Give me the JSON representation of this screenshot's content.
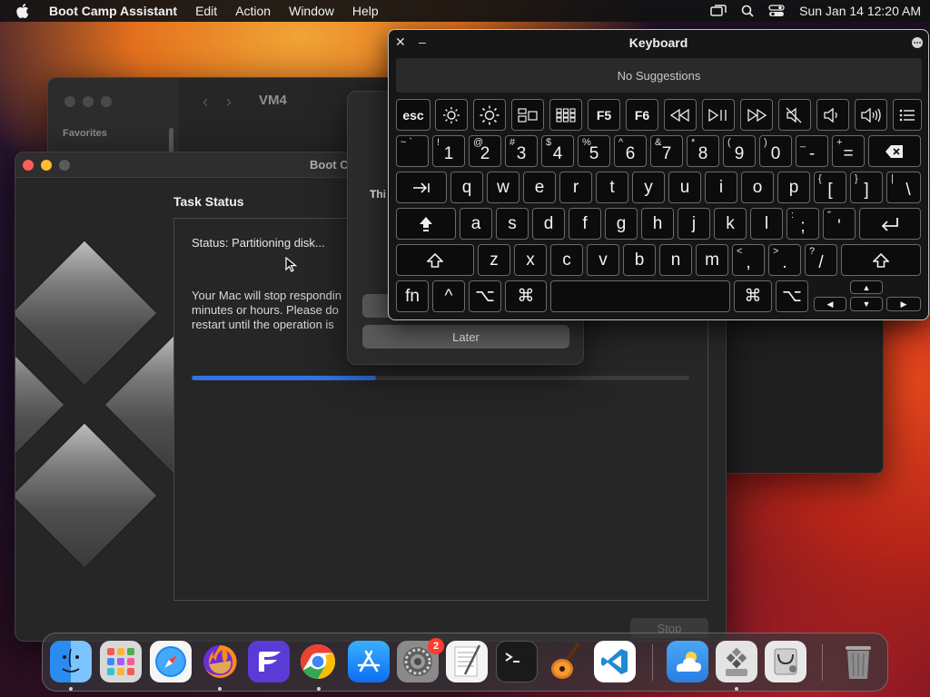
{
  "menubar": {
    "app_name": "Boot Camp Assistant",
    "items": [
      "Edit",
      "Action",
      "Window",
      "Help"
    ],
    "clock": "Sun Jan 14  12:20 AM"
  },
  "vm_window": {
    "title": "VM4",
    "sidebar_heading": "Favorites"
  },
  "bootcamp": {
    "title": "Boot C",
    "task_heading": "Task Status",
    "status": "Status: Partitioning disk...",
    "warning": "Your Mac will stop respondin\nminutes or hours. Please do\nrestart until the operation is",
    "progress": 0.37,
    "stop_label": "Stop"
  },
  "dialog": {
    "text": "Thi",
    "later_label": "Later"
  },
  "keyboard": {
    "title": "Keyboard",
    "suggestions": "No Suggestions",
    "keys": {
      "esc": "esc",
      "f5": "F5",
      "f6": "F6",
      "tilde_alt": "~ `",
      "n1": "1",
      "n1_alt": "!",
      "n2": "2",
      "n2_alt": "@",
      "n3": "3",
      "n3_alt": "#",
      "n4": "4",
      "n4_alt": "$",
      "n5": "5",
      "n5_alt": "%",
      "n6": "6",
      "n6_alt": "^",
      "n7": "7",
      "n7_alt": "&",
      "n8": "8",
      "n8_alt": "*",
      "n9": "9",
      "n9_alt": "(",
      "n0": "0",
      "n0_alt": ")",
      "minus": "-",
      "minus_alt": "_",
      "equals": "=",
      "equals_alt": "+",
      "q": "q",
      "w": "w",
      "e": "e",
      "r": "r",
      "t": "t",
      "y": "y",
      "u": "u",
      "i": "i",
      "o": "o",
      "p": "p",
      "lbracket": "[",
      "lbracket_alt": "{",
      "rbracket": "]",
      "rbracket_alt": "}",
      "backslash": "\\",
      "backslash_alt": "|",
      "a": "a",
      "s": "s",
      "d": "d",
      "f": "f",
      "g": "g",
      "h": "h",
      "j": "j",
      "k": "k",
      "l": "l",
      "semicolon": ";",
      "semicolon_alt": ":",
      "quote": "'",
      "quote_alt": "\"",
      "z": "z",
      "x": "x",
      "c": "c",
      "v": "v",
      "b": "b",
      "n": "n",
      "m": "m",
      "comma": ",",
      "comma_alt": "<",
      "period": ".",
      "period_alt": ">",
      "slash": "/",
      "slash_alt": "?",
      "fn": "fn",
      "ctrl": "^",
      "opt": "⌥",
      "cmd": "⌘"
    }
  },
  "dock": {
    "settings_badge": "2",
    "apps": [
      "Finder",
      "Launchpad",
      "Safari",
      "Firefox",
      "Fantastical",
      "Chrome",
      "App Store",
      "System Settings",
      "TextEdit",
      "Terminal",
      "GarageBand",
      "VS Code",
      "Weather",
      "Boot Camp Assistant",
      "Disk Utility",
      "Trash"
    ]
  },
  "colors": {
    "accent": "#2f74e6",
    "close": "#ff5f57",
    "minimize": "#febc2e",
    "badge": "#ff3b30"
  }
}
